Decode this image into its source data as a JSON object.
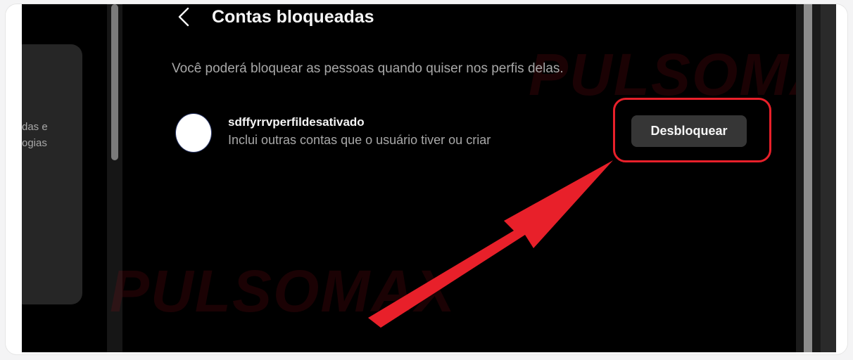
{
  "header": {
    "title": "Contas bloqueadas",
    "back_icon": "chevron-left-icon"
  },
  "description": "Você poderá bloquear as pessoas quando quiser nos perfis delas.",
  "sidebar": {
    "partial_text": "das e\nogias"
  },
  "blocked_accounts": [
    {
      "username": "sdffyrrvperfildesativado",
      "subtext": "Inclui outras contas que o usuário tiver ou criar",
      "action_label": "Desbloquear"
    }
  ],
  "watermark": {
    "text": "PULSOMAX"
  },
  "colors": {
    "background": "#000000",
    "text_primary": "#f5f5f5",
    "text_secondary": "#a8a8a8",
    "button_bg": "#363636",
    "annotation_red": "#e8202a"
  }
}
